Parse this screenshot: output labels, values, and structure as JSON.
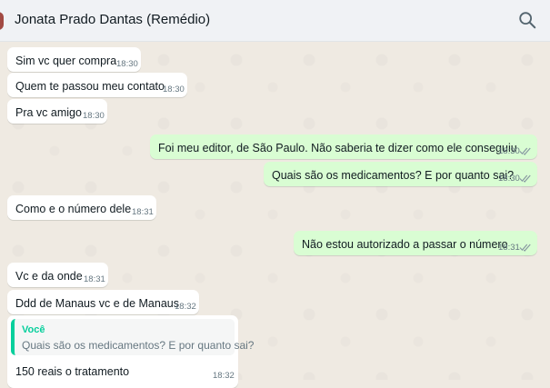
{
  "header": {
    "title": "Jonata Prado Dantas (Remédio)",
    "search_icon": "search-icon"
  },
  "colors": {
    "incoming": "#ffffff",
    "outgoing": "#d9fdd3",
    "quote_accent": "#06cf9c",
    "tick": "#8696a0"
  },
  "messages": [
    {
      "text": "Sim vc quer compra",
      "time": "18:30",
      "direction": "in"
    },
    {
      "text": "Quem te passou meu contato",
      "time": "18:30",
      "direction": "in"
    },
    {
      "text": "Pra vc amigo",
      "time": "18:30",
      "direction": "in"
    },
    {
      "text": "Foi meu editor, de São Paulo. Não saberia te dizer como ele conseguiu",
      "time": "18:30",
      "direction": "out"
    },
    {
      "text": "Quais são os medicamentos? E por quanto sai?",
      "time": "18:30",
      "direction": "out"
    },
    {
      "text": "Como e o número dele",
      "time": "18:31",
      "direction": "in"
    },
    {
      "text": "Não estou autorizado a passar o número",
      "time": "18:31",
      "direction": "out"
    },
    {
      "text": "Vc e da onde",
      "time": "18:31",
      "direction": "in"
    },
    {
      "text": "Ddd de Manaus vc e de Manaus",
      "time": "18:32",
      "direction": "in"
    },
    {
      "text": "150 reais o tratamento",
      "time": "18:32",
      "direction": "in",
      "quote": {
        "author": "Você",
        "text": "Quais são os medicamentos? E por quanto sai?"
      }
    }
  ]
}
